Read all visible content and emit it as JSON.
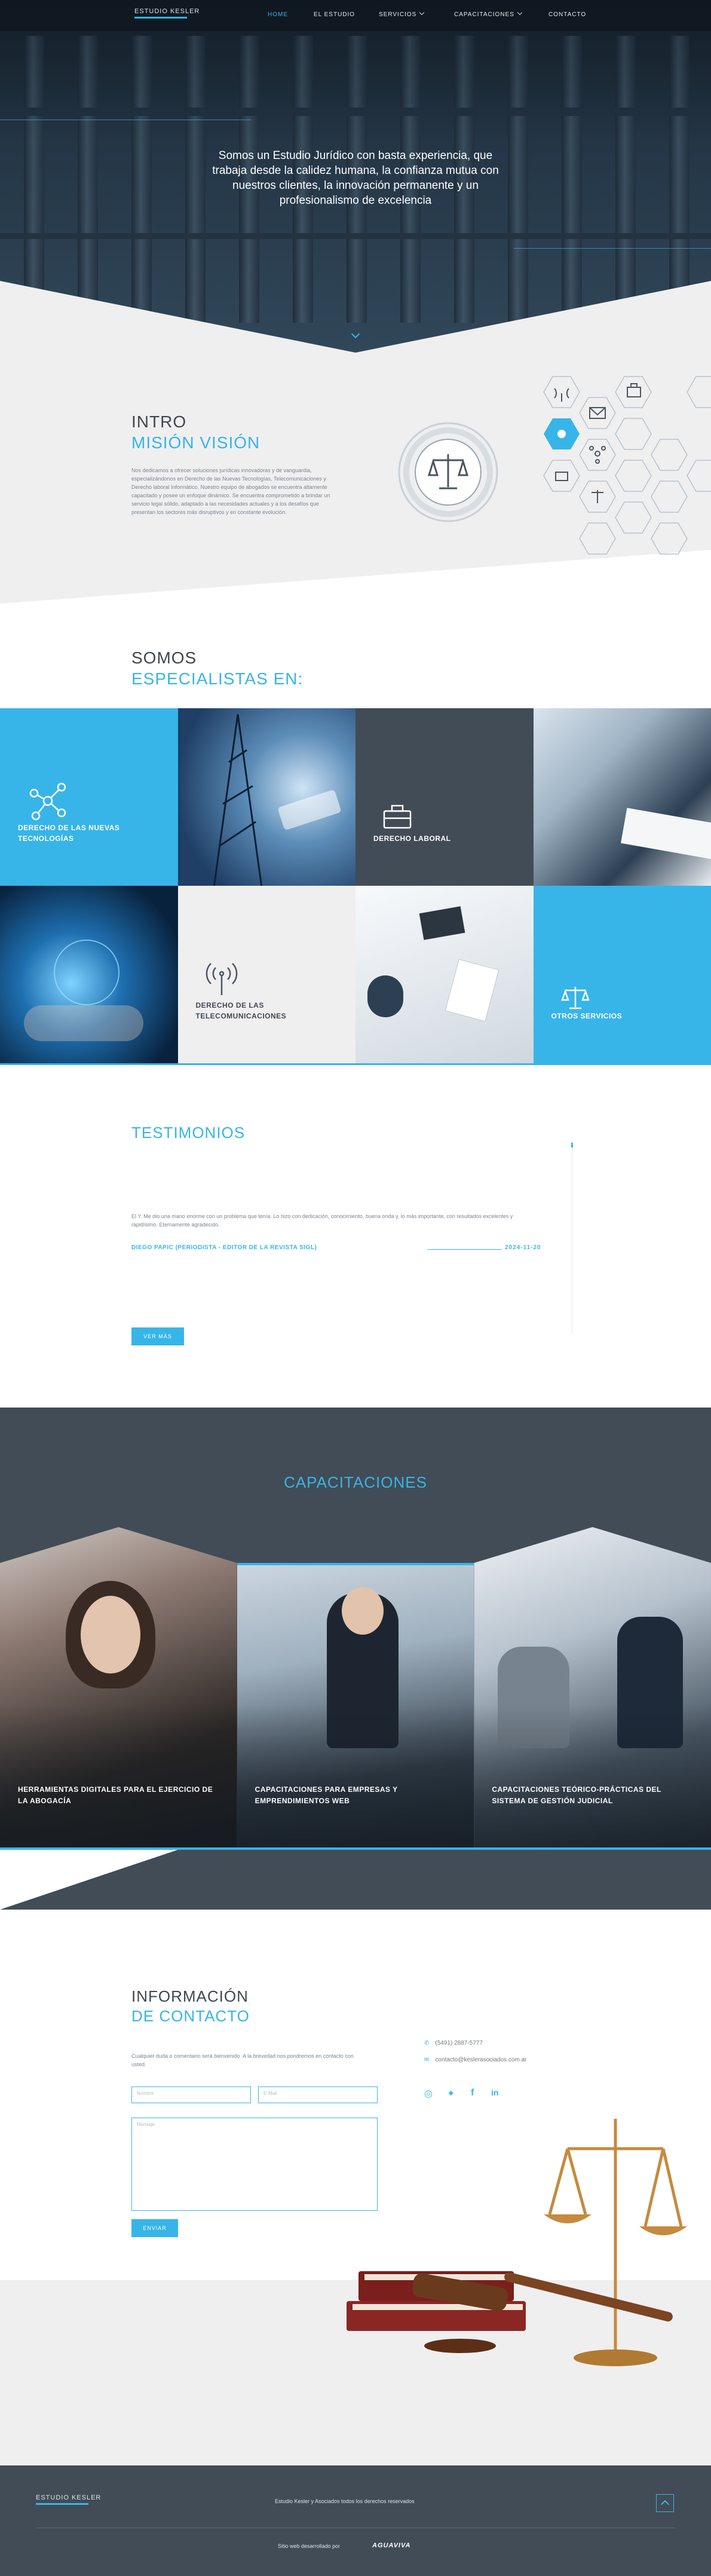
{
  "brand": {
    "logo_text": "ESTUDIO KESLER",
    "accent": "#37b5e8",
    "dark": "#424c56"
  },
  "nav": {
    "items": [
      {
        "label": "HOME",
        "active": true
      },
      {
        "label": "EL ESTUDIO",
        "active": false
      },
      {
        "label": "SERVICIOS",
        "active": false,
        "dropdown": true
      },
      {
        "label": "CAPACITACIONES",
        "active": false,
        "dropdown": true
      },
      {
        "label": "CONTACTO",
        "active": false
      }
    ]
  },
  "hero": {
    "text": "Somos un Estudio Jurídico con basta experiencia, que trabaja desde la calidez humana, la confianza mutua con nuestros clientes, la innovación permanente y un profesionalismo de excelencia"
  },
  "mission": {
    "title_dark": "INTRO",
    "title_blue": "MISIÓN VISIÓN",
    "body": "Nos dedicamos a ofrecer soluciones jurídicas innovadoras y de vanguardia, especializándonos en Derecho de las Nuevas Tecnologías, Telecomunicaciones y Derecho laboral Informático. Nuestro equipo de abogados se encuentra altamente capacitado y posee un enfoque dinámico. Se encuentra comprometido a brindar un servicio legal sólido, adaptado a las necesidades actuales y a los desafíos que presentan los sectores más disruptivos y en constante evolución."
  },
  "specialists": {
    "title_dark": "SOMOS",
    "title_blue": "ESPECIALISTAS EN:",
    "tiles": [
      {
        "label": "DERECHO DE LAS NUEVAS TECNOLOGÍAS",
        "icon": "network-icon"
      },
      {
        "label": "",
        "icon": "telecom-tower-image"
      },
      {
        "label": "DERECHO LABORAL",
        "icon": "briefcase-icon"
      },
      {
        "label": "",
        "icon": "meeting-image"
      },
      {
        "label": "",
        "icon": "digital-hand-image"
      },
      {
        "label": "DERECHO DE LAS TELECOMUNICACIONES",
        "icon": "antenna-icon"
      },
      {
        "label": "",
        "icon": "handshake-image"
      },
      {
        "label": "OTROS SERVICIOS",
        "icon": "scales-icon"
      }
    ]
  },
  "testimonials": {
    "title": "TESTIMONIOS",
    "quote": "El Y. Me dio una mano enorme con un problema que tenía. Lo hizo con dedicación, conocimiento, buena onda y, lo más importante, con resultados excelentes y rapidísimo. Eternamente agradecido.",
    "author": "DIEGO PAPIC (PERIODISTA - EDITOR DE LA REVISTA SIGL)",
    "date": "2024-11-20",
    "button": "VER MÁS"
  },
  "training": {
    "title": "CAPACITACIONES",
    "cards": [
      {
        "label": "HERRAMIENTAS DIGITALES PARA EL EJERCICIO DE LA ABOGACÍA"
      },
      {
        "label": "CAPACITACIONES PARA EMPRESAS Y EMPRENDIMIENTOS WEB"
      },
      {
        "label": "CAPACITACIONES TEÓRICO-PRÁCTICAS DEL SISTEMA DE GESTIÓN JUDICIAL"
      }
    ]
  },
  "contact": {
    "title_dark": "INFORMACIÓN",
    "title_blue": "DE CONTACTO",
    "intro": "Cualquier duda o comentario será bienvenido. A la brevedad nos pondremos en contacto con usted.",
    "name_placeholder": "Nombre",
    "email_placeholder": "E-Mail",
    "message_placeholder": "Mensaje",
    "submit": "ENVIAR",
    "phone": "(5491) 2887-5777",
    "email": "contacto@keslerasociados.com.ar"
  },
  "footer": {
    "logo_text": "ESTUDIO KESLER",
    "rights": "Estudio Kesler y Asociados todos los derechos reservados",
    "credit": "Sitio web desarrollado por",
    "credit_brand": "AGUAVIVA"
  }
}
